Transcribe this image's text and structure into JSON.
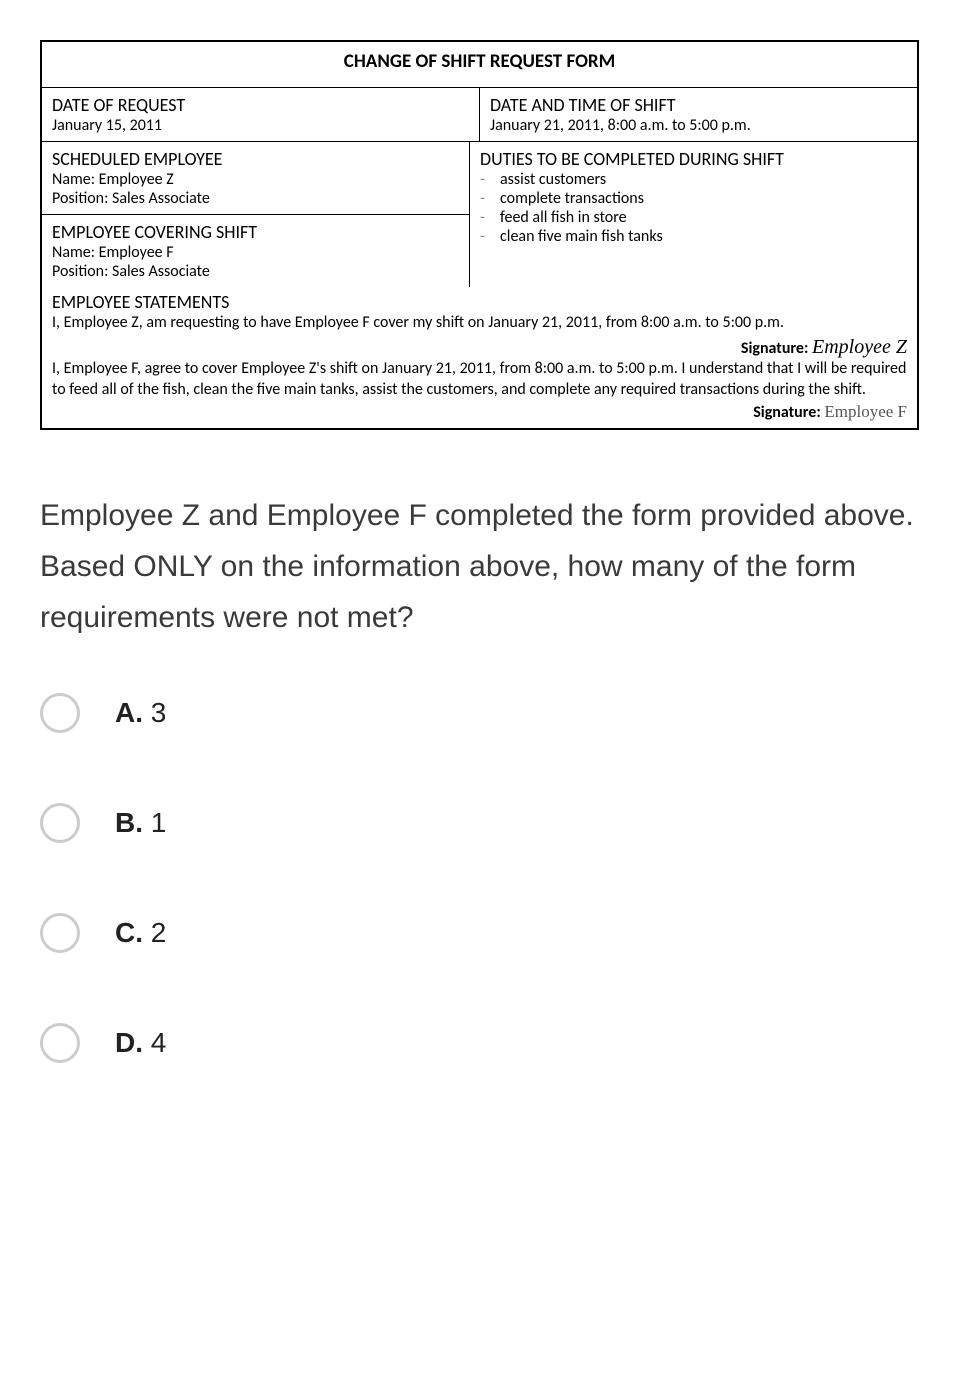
{
  "form": {
    "title": "CHANGE OF SHIFT REQUEST FORM",
    "date_request_label": "DATE OF REQUEST",
    "date_request_value": "January 15, 2011",
    "date_shift_label": "DATE AND TIME OF SHIFT",
    "date_shift_value": "January 21, 2011, 8:00 a.m. to 5:00 p.m.",
    "scheduled_label": "SCHEDULED EMPLOYEE",
    "scheduled_name": "Name:  Employee Z",
    "scheduled_position": "Position:  Sales Associate",
    "covering_label": "EMPLOYEE COVERING SHIFT",
    "covering_name": "Name:  Employee F",
    "covering_position": "Position:  Sales Associate",
    "duties_label": "DUTIES TO BE COMPLETED DURING SHIFT",
    "duties": {
      "0": "assist customers",
      "1": "complete transactions",
      "2": "feed all fish in store",
      "3": "clean five main fish tanks"
    },
    "statements_label": "EMPLOYEE STATEMENTS",
    "statement_z": "I, Employee Z, am requesting to have Employee F cover my shift on January 21, 2011, from 8:00 a.m. to 5:00 p.m.",
    "signature_label": "Signature:  ",
    "signature_z": "Employee Z",
    "statement_f": "I, Employee F, agree to cover Employee Z's shift on January 21, 2011, from 8:00 a.m. to 5:00 p.m. I understand that I will be required to feed all of the fish, clean the five main tanks, assist the customers, and complete any required transactions during the shift.",
    "signature_f": "Employee F"
  },
  "question": "Employee Z and Employee F completed the form provided above.  Based ONLY on the information above, how many of the form requirements were not met?",
  "options": {
    "a": {
      "letter": "A.",
      "text": " 3"
    },
    "b": {
      "letter": "B.",
      "text": " 1"
    },
    "c": {
      "letter": "C.",
      "text": " 2"
    },
    "d": {
      "letter": "D.",
      "text": " 4"
    }
  }
}
